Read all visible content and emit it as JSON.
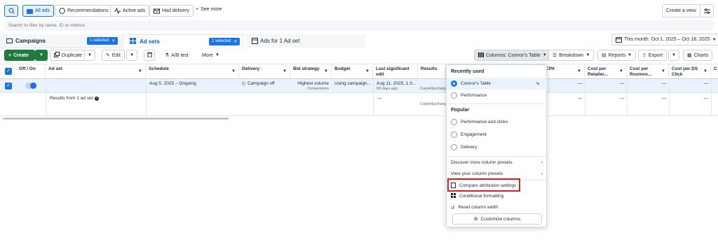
{
  "filters": {
    "all_ads": "All ads",
    "recommendations": "Recommendations",
    "active_ads": "Active ads",
    "had_delivery": "Had delivery",
    "see_more": "See more",
    "create_view": "Create a view"
  },
  "search": {
    "placeholder": "Search to filter by name, ID or metrics"
  },
  "tabs": {
    "campaigns": "Campaigns",
    "campaigns_selected": "1 selected",
    "adsets": "Ad sets",
    "adsets_selected": "1 selected",
    "ads": "Ads for 1 Ad set"
  },
  "date_range": "This month: Oct 1, 2025 – Oct 18, 2025",
  "toolbar": {
    "create": "Create",
    "duplicate": "Duplicate",
    "edit": "Edit",
    "ab_test": "A/B test",
    "more": "More",
    "columns": "Columns: Connor's Table",
    "breakdown": "Breakdown",
    "reports": "Reports",
    "export": "Export",
    "charts": "Charts"
  },
  "columns": {
    "off_on": "Off / On",
    "adset": "Ad set",
    "schedule": "Schedule",
    "delivery": "Delivery",
    "bid_strategy": "Bid strategy",
    "budget": "Budget",
    "last_edit": "Last significant edit",
    "results": "Results",
    "cpa": "CPA",
    "cost_retailer": "Cost per Retailer...",
    "cost_roomvo": "Cost per Roomvo...",
    "cost_ds": "Cost per DS Click",
    "extra": "C"
  },
  "row": {
    "schedule": "Aug 5, 2025 – Ongoing",
    "delivery": "Campaign off",
    "bid": "Highest volume",
    "bid_sub": "Conversions",
    "budget": "Using campaign...",
    "last_edit": "Aug 11, 2025, 1:3...",
    "last_edit_sub": "68 days ago",
    "results": "CarpetExchang",
    "dash": "—"
  },
  "summary": {
    "label": "Results from 1 ad set",
    "last_edit": "—",
    "results": "CarpetExchang"
  },
  "dropdown": {
    "recently_used": "Recently used",
    "connors_table": "Connor's Table",
    "performance": "Performance",
    "popular": "Popular",
    "perf_clicks": "Performance and clicks",
    "engagement": "Engagement",
    "delivery": "Delivery",
    "discover": "Discover more column presets",
    "view_presets": "View your column presets",
    "compare": "Compare attribution settings",
    "conditional": "Conditional formatting",
    "reset": "Reset column width",
    "customize": "Customize columns",
    "highlight_color": "#c62828"
  }
}
